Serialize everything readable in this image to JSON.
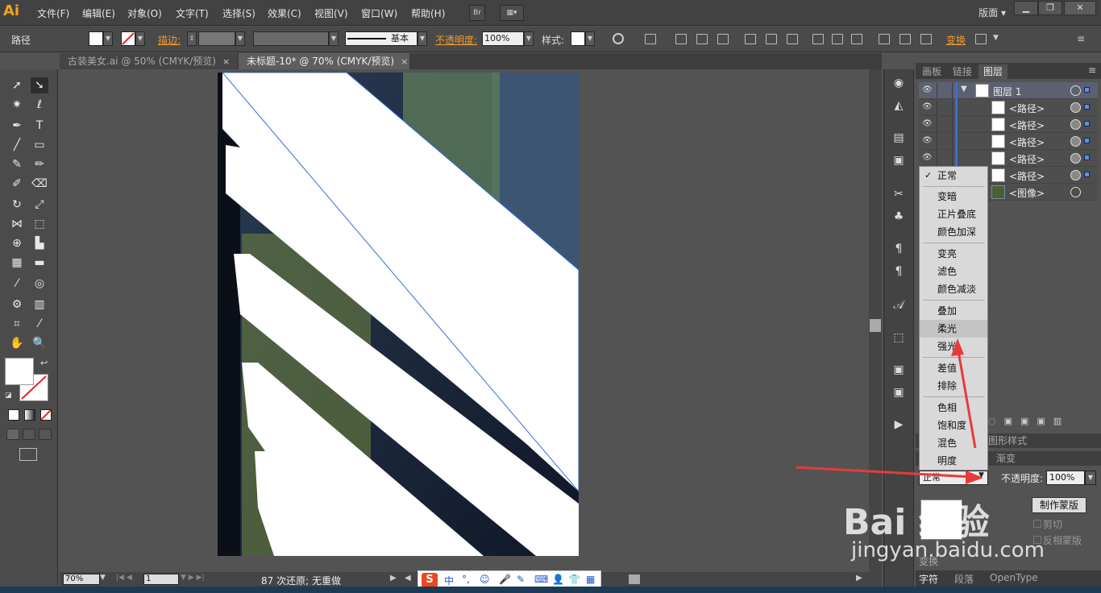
{
  "app": {
    "logo": "Ai"
  },
  "menu": [
    "文件(F)",
    "编辑(E)",
    "对象(O)",
    "文字(T)",
    "选择(S)",
    "效果(C)",
    "视图(V)",
    "窗口(W)",
    "帮助(H)"
  ],
  "menubar": {
    "bridge_button": "Br",
    "workspace": "版面 ▾"
  },
  "control_bar": {
    "object_label": "路径",
    "stroke_label": "描边:",
    "stroke_style": "基本",
    "opacity_label": "不透明度:",
    "opacity_value": "100%",
    "style_label": "样式:",
    "transform_label": "变换"
  },
  "tabs": [
    {
      "label": "古装美女.ai @ 50% (CMYK/预览)",
      "close": "×"
    },
    {
      "label": "未标题-10* @ 70% (CMYK/预览)",
      "close": "×"
    }
  ],
  "right_panel": {
    "tabs": [
      "画板",
      "链接",
      "图层"
    ],
    "active_tab": "图层",
    "layers": [
      {
        "label": "图层 1"
      },
      {
        "label": "<路径>"
      },
      {
        "label": "<路径>"
      },
      {
        "label": "<路径>"
      },
      {
        "label": "<路径>"
      },
      {
        "label": "<路径>"
      },
      {
        "label": "<图像>"
      }
    ],
    "panel_tabs_mid": [
      "图形样式",
      "渐变"
    ]
  },
  "blend_menu": {
    "checked": "✓",
    "groups": [
      [
        "正常"
      ],
      [
        "变暗",
        "正片叠底",
        "颜色加深"
      ],
      [
        "变亮",
        "滤色",
        "颜色减淡"
      ],
      [
        "叠加",
        "柔光",
        "强光"
      ],
      [
        "差值",
        "排除"
      ],
      [
        "色相",
        "饱和度",
        "混色",
        "明度"
      ]
    ],
    "highlighted": "柔光"
  },
  "transparency": {
    "mode": "正常",
    "opacity_label": "不透明度:",
    "opacity_value": "100%",
    "make_mask": "制作蒙版",
    "clip": "剪切",
    "invert": "反相蒙版"
  },
  "status": {
    "zoom": "70%",
    "page": "1",
    "text": "87  次还原; 无重做"
  },
  "ime": {
    "logo": "S",
    "items": [
      "中",
      "°,",
      "☺",
      "🎤",
      "✎",
      "⌨",
      "👤",
      "👕",
      "▦"
    ]
  },
  "bottom_tabs": [
    "变换",
    "字符",
    "段落",
    "OpenType"
  ],
  "watermark": {
    "logo": "Bai 经验",
    "url": "jingyan.baidu.com"
  },
  "colors": {
    "accent_orange": "#f59b2c",
    "layer_blue": "#3b6fd6",
    "arrow_red": "#e83a3a"
  }
}
